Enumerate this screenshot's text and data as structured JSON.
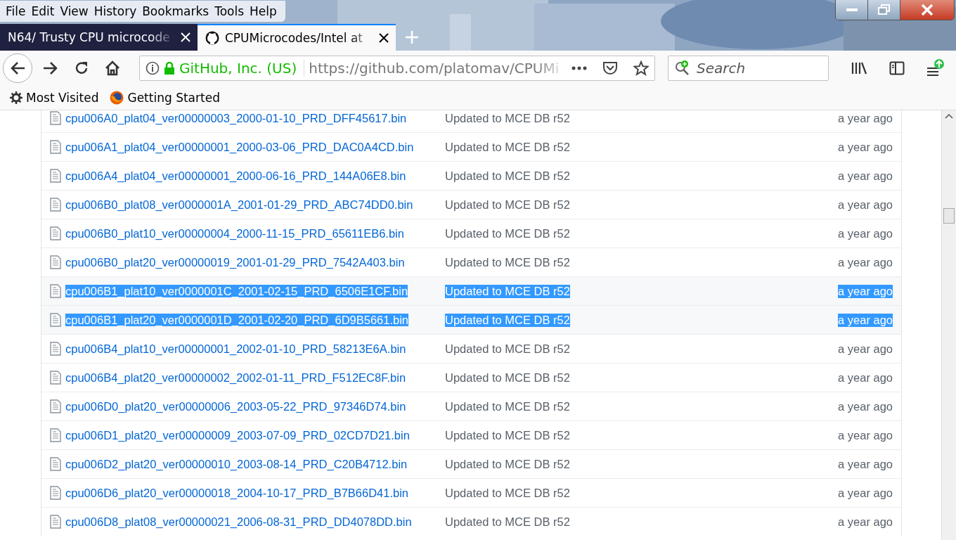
{
  "menu": [
    "File",
    "Edit",
    "View",
    "History",
    "Bookmarks",
    "Tools",
    "Help"
  ],
  "tabs": [
    {
      "title": "N64/ Trusty CPU microcode",
      "selected": false
    },
    {
      "title": "CPUMicrocodes/Intel at",
      "selected": true
    }
  ],
  "address_bar": {
    "identity": "GitHub, Inc. (US)",
    "url": "https://github.com/platomav/CPUMi"
  },
  "search": {
    "placeholder": "Search"
  },
  "bookmarks": [
    "Most Visited",
    "Getting Started"
  ],
  "files": [
    {
      "name": "cpu006A0_plat04_ver00000003_2000-01-10_PRD_DFF45617.bin",
      "message": "Updated to MCE DB r52",
      "age": "a year ago",
      "selected": false
    },
    {
      "name": "cpu006A1_plat04_ver00000001_2000-03-06_PRD_DAC0A4CD.bin",
      "message": "Updated to MCE DB r52",
      "age": "a year ago",
      "selected": false
    },
    {
      "name": "cpu006A4_plat04_ver00000001_2000-06-16_PRD_144A06E8.bin",
      "message": "Updated to MCE DB r52",
      "age": "a year ago",
      "selected": false
    },
    {
      "name": "cpu006B0_plat08_ver0000001A_2001-01-29_PRD_ABC74DD0.bin",
      "message": "Updated to MCE DB r52",
      "age": "a year ago",
      "selected": false
    },
    {
      "name": "cpu006B0_plat10_ver00000004_2000-11-15_PRD_65611EB6.bin",
      "message": "Updated to MCE DB r52",
      "age": "a year ago",
      "selected": false
    },
    {
      "name": "cpu006B0_plat20_ver00000019_2001-01-29_PRD_7542A403.bin",
      "message": "Updated to MCE DB r52",
      "age": "a year ago",
      "selected": false
    },
    {
      "name": "cpu006B1_plat10_ver0000001C_2001-02-15_PRD_6506E1CF.bin",
      "message": "Updated to MCE DB r52",
      "age": "a year ago",
      "selected": true
    },
    {
      "name": "cpu006B1_plat20_ver0000001D_2001-02-20_PRD_6D9B5661.bin",
      "message": "Updated to MCE DB r52",
      "age": "a year ago",
      "selected": true
    },
    {
      "name": "cpu006B4_plat10_ver00000001_2002-01-10_PRD_58213E6A.bin",
      "message": "Updated to MCE DB r52",
      "age": "a year ago",
      "selected": false
    },
    {
      "name": "cpu006B4_plat20_ver00000002_2002-01-11_PRD_F512EC8F.bin",
      "message": "Updated to MCE DB r52",
      "age": "a year ago",
      "selected": false
    },
    {
      "name": "cpu006D0_plat20_ver00000006_2003-05-22_PRD_97346D74.bin",
      "message": "Updated to MCE DB r52",
      "age": "a year ago",
      "selected": false
    },
    {
      "name": "cpu006D1_plat20_ver00000009_2003-07-09_PRD_02CD7D21.bin",
      "message": "Updated to MCE DB r52",
      "age": "a year ago",
      "selected": false
    },
    {
      "name": "cpu006D2_plat20_ver00000010_2003-08-14_PRD_C20B4712.bin",
      "message": "Updated to MCE DB r52",
      "age": "a year ago",
      "selected": false
    },
    {
      "name": "cpu006D6_plat20_ver00000018_2004-10-17_PRD_B7B66D41.bin",
      "message": "Updated to MCE DB r52",
      "age": "a year ago",
      "selected": false
    },
    {
      "name": "cpu006D8_plat08_ver00000021_2006-08-31_PRD_DD4078DD.bin",
      "message": "Updated to MCE DB r52",
      "age": "a year ago",
      "selected": false
    }
  ]
}
